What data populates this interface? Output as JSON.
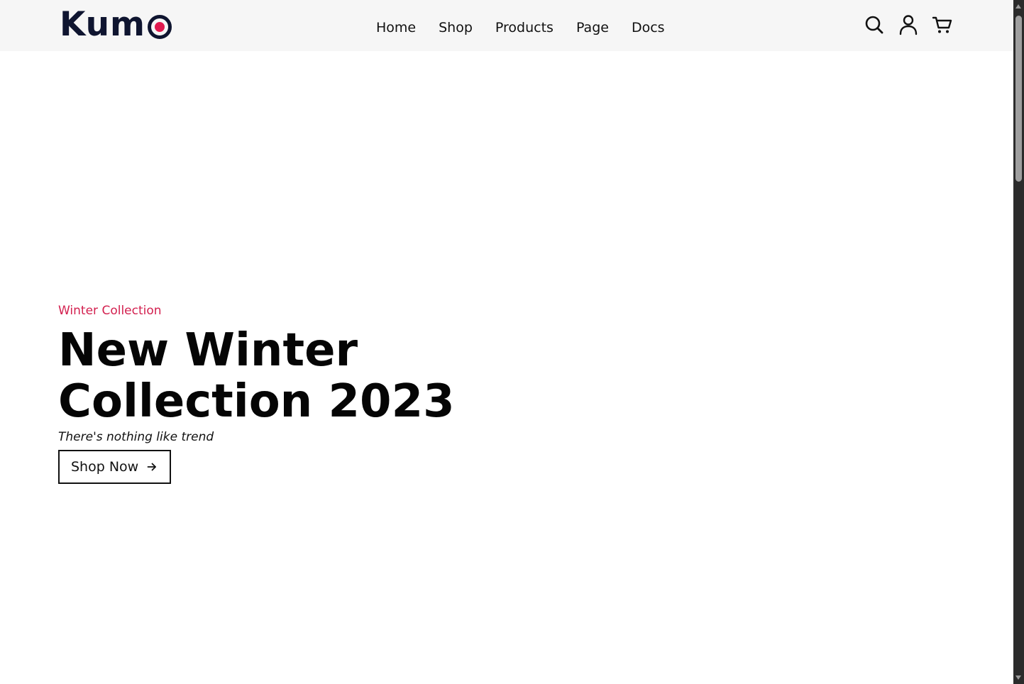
{
  "header": {
    "logo_text": "Kum",
    "logo_accent_color": "#e01a4f",
    "nav": [
      {
        "label": "Home"
      },
      {
        "label": "Shop"
      },
      {
        "label": "Products"
      },
      {
        "label": "Page"
      },
      {
        "label": "Docs"
      }
    ],
    "icons": [
      "search-icon",
      "user-icon",
      "cart-icon"
    ]
  },
  "hero": {
    "eyebrow": "Winter Collection",
    "title": "New Winter Collection 2023",
    "subtitle": "There's nothing like trend",
    "cta_label": "Shop Now",
    "cta_icon": "arrow-right-icon",
    "eyebrow_color": "#d3204f"
  }
}
